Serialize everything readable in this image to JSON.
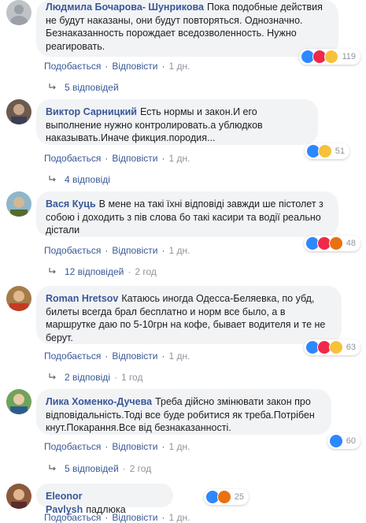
{
  "ui": {
    "like_label": "Подобається",
    "reply_label": "Відповісти",
    "dot": "·"
  },
  "comments": [
    {
      "author": "Людмила Бочарова- Шунрикова",
      "text": "Пока подобные действия не будут наказаны, они будут повторяться. Однозначно. Безнаказанность порождает вседозволенность. Нужно реагировать.",
      "time": "1 дн.",
      "reaction_count": "119",
      "reactions": [
        "like-icon",
        "love-icon",
        "wow-icon"
      ],
      "replies_label": "5 відповідей",
      "replies_time": ""
    },
    {
      "author": "Виктор Сарницкий",
      "text": "Есть нормы и закон.И его выполнение нужно контролировать.а ублюдков наказывать.Иначе фикция.породия...",
      "time": "1 дн.",
      "reaction_count": "51",
      "reactions": [
        "like-icon",
        "sad-icon"
      ],
      "replies_label": "4 відповіді",
      "replies_time": ""
    },
    {
      "author": "Вася Куць",
      "text": "В мене на такі їхні відповіді завжди ше пістолет з собою і доходить з пів слова бо такі касири та водії реально дістали",
      "time": "1 дн.",
      "reaction_count": "48",
      "reactions": [
        "like-icon",
        "love-icon",
        "angry-icon"
      ],
      "replies_label": "12 відповідей",
      "replies_time": "2 год"
    },
    {
      "author": "Roman Hretsov",
      "text": "Катаюсь иногда Одесса-Беляевка, по убд, билеты всегда брал бесплатно и норм все было, а в маршрутке даю по 5-10грн на кофе, бывает водителя и те не берут.",
      "time": "1 дн.",
      "reaction_count": "63",
      "reactions": [
        "like-icon",
        "love-icon",
        "wow-icon"
      ],
      "replies_label": "2 відповіді",
      "replies_time": "1 год"
    },
    {
      "author": "Лика Хоменко-Дучева",
      "text": "Треба дійсно змінювати закон про відповідальність.Тоді все буде робитися як треба.Потрібен кнут.Покарання.Все від безнаказанності.",
      "time": "1 дн.",
      "reaction_count": "60",
      "reactions": [
        "like-icon"
      ],
      "replies_label": "5 відповідей",
      "replies_time": "2 год"
    },
    {
      "author": "Eleonor Pavlysh",
      "text": "падлюка",
      "time": "1 дн.",
      "reaction_count": "25",
      "reactions": [
        "like-icon",
        "angry-icon"
      ],
      "replies_label": "",
      "replies_time": ""
    }
  ]
}
